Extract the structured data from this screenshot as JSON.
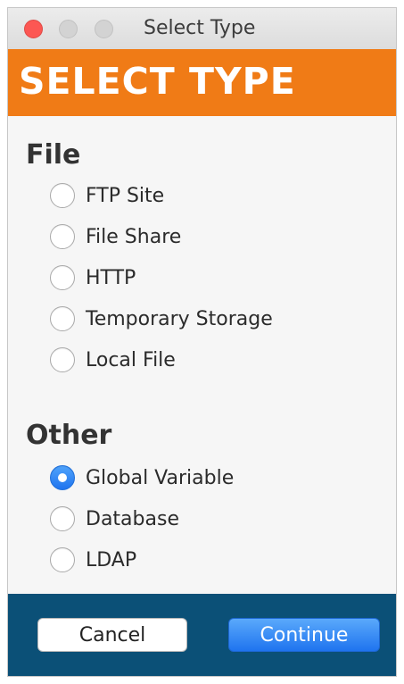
{
  "window": {
    "title": "Select Type"
  },
  "banner": {
    "title": "SELECT TYPE"
  },
  "sections": [
    {
      "heading": "File",
      "options": [
        {
          "label": "FTP Site",
          "selected": false
        },
        {
          "label": "File Share",
          "selected": false
        },
        {
          "label": "HTTP",
          "selected": false
        },
        {
          "label": "Temporary Storage",
          "selected": false
        },
        {
          "label": "Local File",
          "selected": false
        }
      ]
    },
    {
      "heading": "Other",
      "options": [
        {
          "label": "Global Variable",
          "selected": true
        },
        {
          "label": "Database",
          "selected": false
        },
        {
          "label": "LDAP",
          "selected": false
        }
      ]
    }
  ],
  "footer": {
    "cancel_label": "Cancel",
    "continue_label": "Continue"
  },
  "colors": {
    "banner": "#f07b16",
    "footer": "#0b5077",
    "accent": "#1f74ef"
  }
}
